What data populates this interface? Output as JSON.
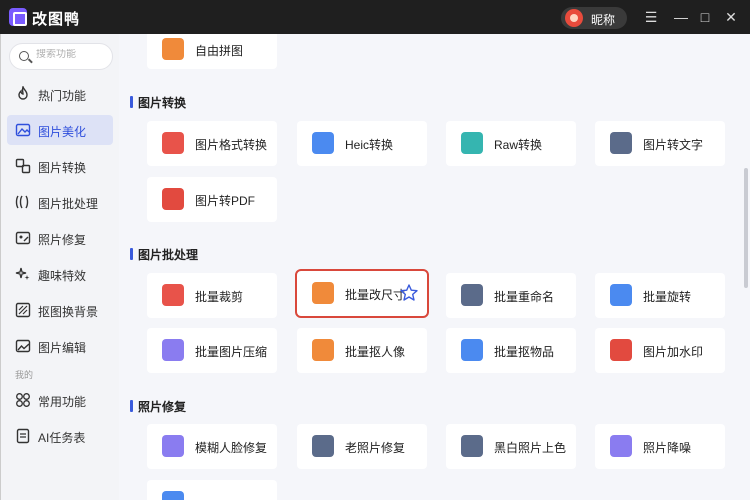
{
  "app": {
    "title": "改图鸭",
    "user_name": "昵称",
    "window_buttons": [
      "☰",
      "—",
      "□",
      "✕"
    ]
  },
  "search": {
    "placeholder": "搜索功能"
  },
  "sidebar": {
    "items": [
      {
        "label": "热门功能",
        "icon": "fire-icon",
        "active": false
      },
      {
        "label": "图片美化",
        "icon": "image-edit-icon",
        "active": true
      },
      {
        "label": "图片转换",
        "icon": "convert-icon",
        "active": false
      },
      {
        "label": "图片批处理",
        "icon": "batch-icon",
        "active": false
      },
      {
        "label": "照片修复",
        "icon": "repair-icon",
        "active": false
      },
      {
        "label": "趣味特效",
        "icon": "sparkle-icon",
        "active": false
      },
      {
        "label": "抠图换背景",
        "icon": "cutout-icon",
        "active": false
      },
      {
        "label": "图片编辑",
        "icon": "edit-icon",
        "active": false
      }
    ],
    "section_label": "我的",
    "my_items": [
      {
        "label": "常用功能",
        "icon": "grid-icon"
      },
      {
        "label": "AI任务表",
        "icon": "task-list-icon"
      }
    ]
  },
  "main": {
    "top_card": {
      "label": "自由拼图",
      "color": "#f08a3a"
    },
    "sections": [
      {
        "title": "图片转换",
        "cards": [
          {
            "label": "图片格式转换",
            "color": "#e8534a"
          },
          {
            "label": "Heic转换",
            "color": "#4b8af0"
          },
          {
            "label": "Raw转换",
            "color": "#35b5b0"
          },
          {
            "label": "图片转文字",
            "color": "#5b6b8a"
          },
          {
            "label": "图片转PDF",
            "color": "#e24a3f"
          }
        ]
      },
      {
        "title": "图片批处理",
        "cards": [
          {
            "label": "批量裁剪",
            "color": "#e8534a"
          },
          {
            "label": "批量改尺寸",
            "color": "#f08a3a",
            "highlighted": true
          },
          {
            "label": "批量重命名",
            "color": "#5b6b8a"
          },
          {
            "label": "批量旋转",
            "color": "#4b8af0"
          },
          {
            "label": "批量图片压缩",
            "color": "#8a7cf0"
          },
          {
            "label": "批量抠人像",
            "color": "#f08a3a"
          },
          {
            "label": "批量抠物品",
            "color": "#4b8af0"
          },
          {
            "label": "图片加水印",
            "color": "#e24a3f"
          }
        ]
      },
      {
        "title": "照片修复",
        "cards": [
          {
            "label": "模糊人脸修复",
            "color": "#8a7cf0"
          },
          {
            "label": "老照片修复",
            "color": "#5b6b8a"
          },
          {
            "label": "黑白照片上色",
            "color": "#5b6b8a"
          },
          {
            "label": "照片降噪",
            "color": "#8a7cf0"
          }
        ]
      }
    ]
  }
}
